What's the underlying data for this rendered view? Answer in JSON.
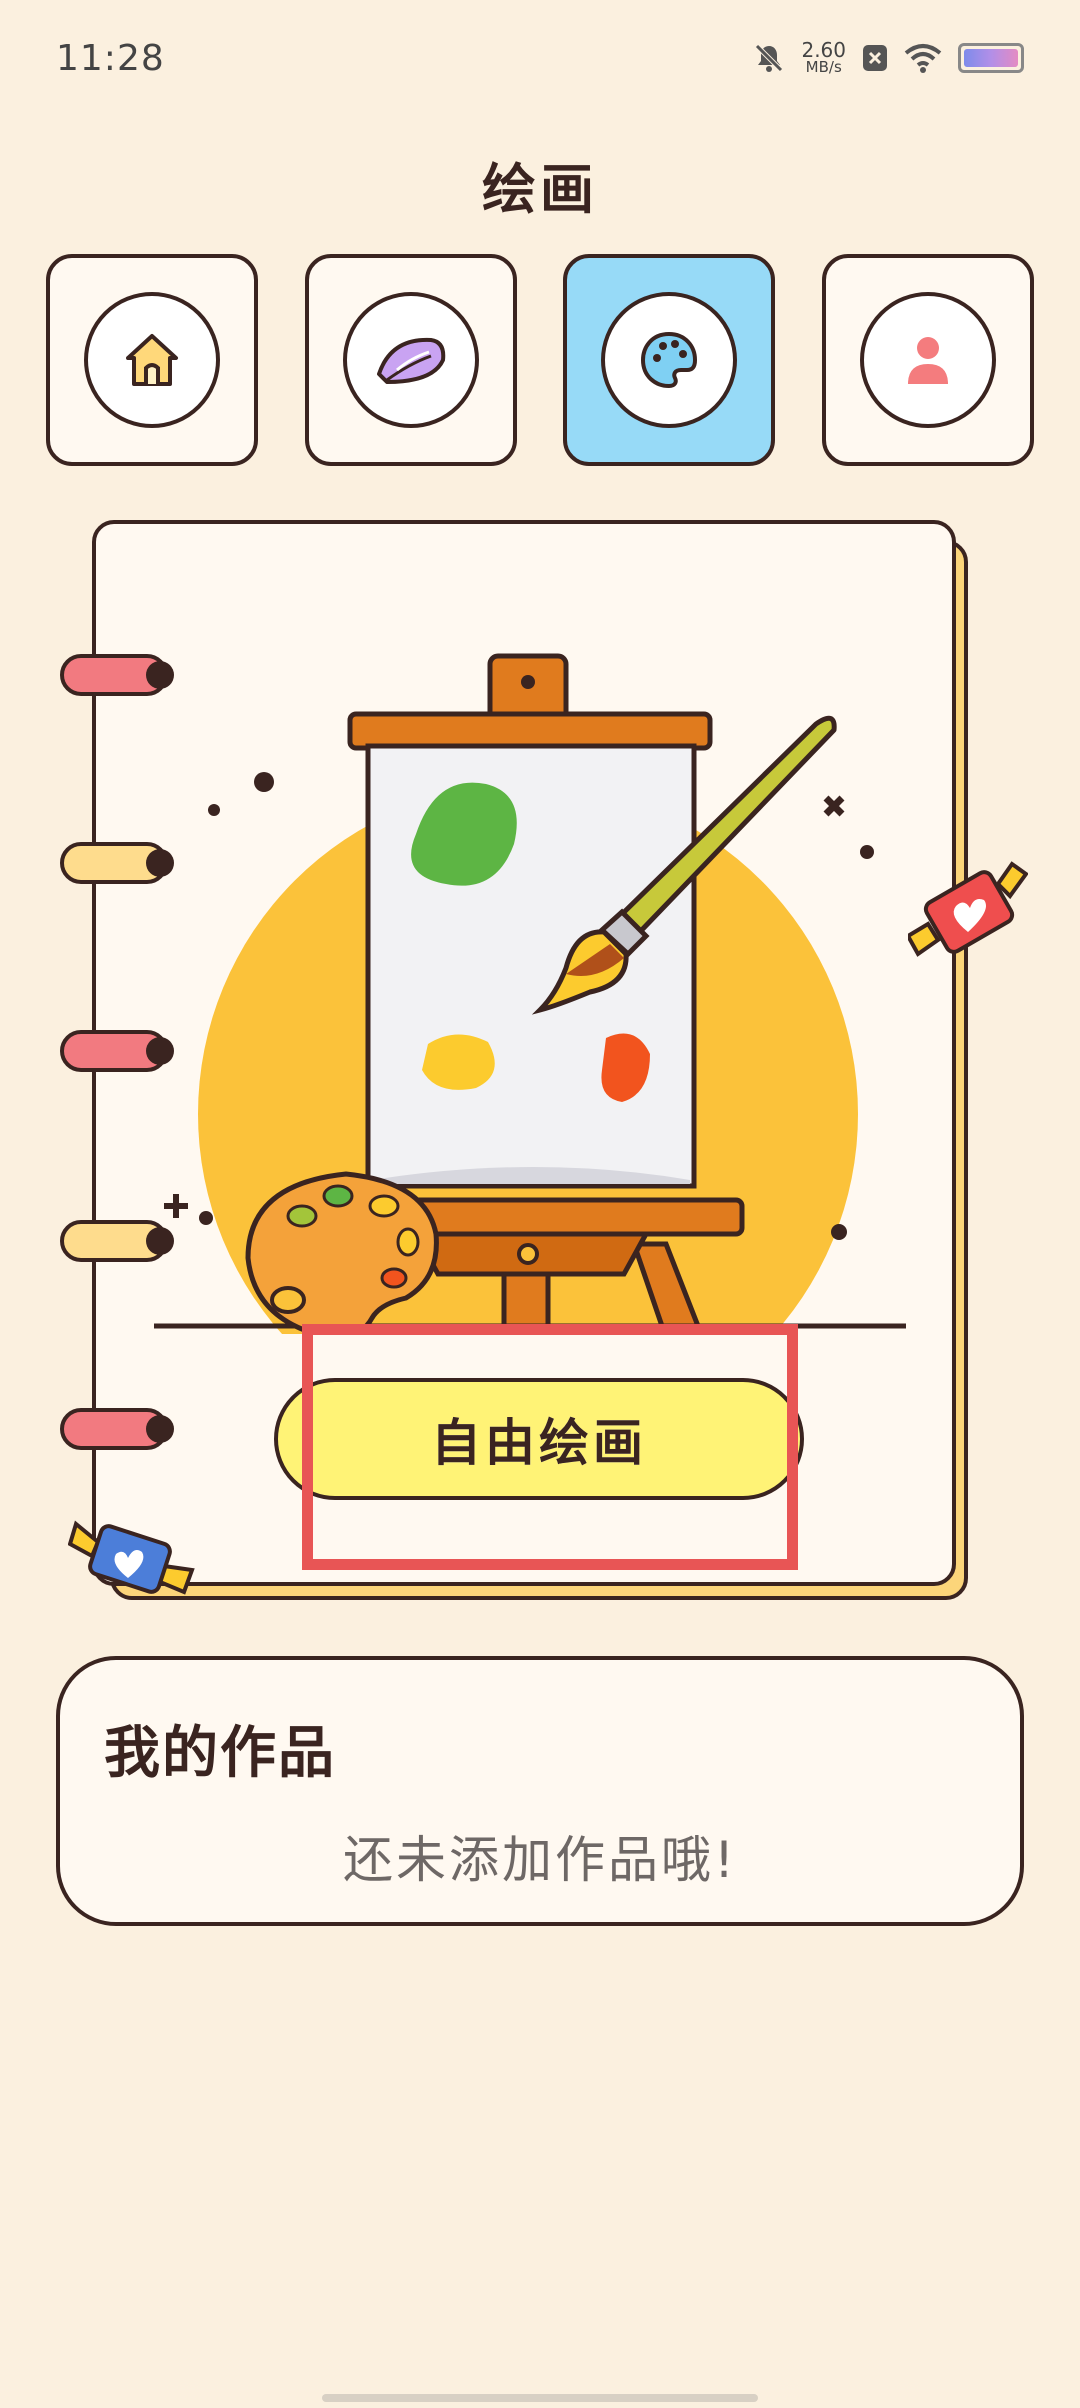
{
  "status_bar": {
    "time": "11:28",
    "net_speed_value": "2.60",
    "net_speed_unit": "MB/s",
    "icons": [
      "mute-bell-icon",
      "notification-x-icon",
      "wifi-icon",
      "battery-icon"
    ]
  },
  "header": {
    "title": "绘画"
  },
  "tabs": [
    {
      "name": "home",
      "icon": "house-icon",
      "active": false
    },
    {
      "name": "leaf",
      "icon": "leaf-icon",
      "active": false
    },
    {
      "name": "palette",
      "icon": "palette-icon",
      "active": true
    },
    {
      "name": "profile",
      "icon": "person-icon",
      "active": false
    }
  ],
  "drawing_card": {
    "button_label": "自由绘画"
  },
  "works": {
    "title": "我的作品",
    "empty_message": "还未添加作品哦!"
  },
  "colors": {
    "background": "#FBF0DF",
    "outline": "#3A2420",
    "active_tab": "#97DAF7",
    "button": "#FFF376",
    "highlight": "#E85555"
  }
}
